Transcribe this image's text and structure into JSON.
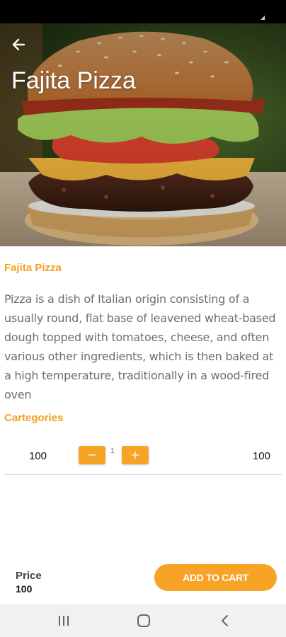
{
  "hero": {
    "title": "Fajita Pizza"
  },
  "product": {
    "name": "Fajita Pizza",
    "description": "Pizza is a dish of Italian origin consisting of a usually round, flat base of leavened wheat-based dough topped with tomatoes, cheese, and often various other ingredients, which is then baked at a high temperature, traditionally in a wood-fired oven"
  },
  "categories": {
    "title": "Cartegories",
    "row": {
      "left_value": "100",
      "minus_label": "−",
      "quantity": "1",
      "plus_label": "+",
      "right_value": "100"
    }
  },
  "footer": {
    "price_label": "Price",
    "price_value": "100",
    "add_to_cart_label": "ADD TO CART"
  },
  "colors": {
    "accent": "#f7a326",
    "heading": "#f5a020",
    "body_text": "#6e6e6e"
  },
  "icons": {
    "back": "arrow-left-icon",
    "nav_recent": "recent-apps-icon",
    "nav_home": "home-icon",
    "nav_back": "chevron-left-icon"
  }
}
